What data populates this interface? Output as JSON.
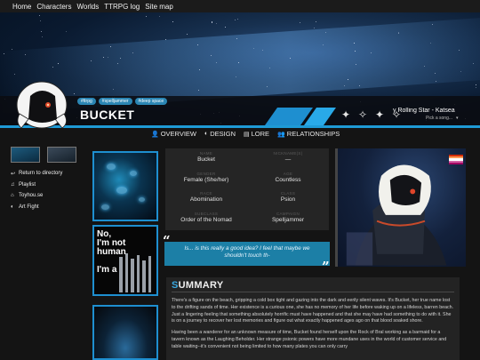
{
  "nav": [
    "Home",
    "Characters",
    "Worlds",
    "TTRPG log",
    "Site map"
  ],
  "profile": {
    "tags": [
      "#ttrpg",
      "#spelljammer",
      "#deep space"
    ],
    "name": "BUCKET",
    "music": {
      "song": "y Rolling Star - Katsea",
      "picker": "Pick a song...",
      "picker_arrow": "▾"
    },
    "sprites": [
      "sprite-a-icon",
      "sprite-b-icon",
      "sprite-c-icon",
      "sprite-d-icon"
    ]
  },
  "tabs": [
    {
      "icon": "person-icon",
      "glyph": "👤",
      "label": "OVERVIEW"
    },
    {
      "icon": "palette-icon",
      "glyph": "◐",
      "label": "DESIGN"
    },
    {
      "icon": "book-icon",
      "glyph": "▤",
      "label": "LORE"
    },
    {
      "icon": "people-icon",
      "glyph": "👥",
      "label": "RELATIONSHIPS"
    }
  ],
  "sidebar": [
    {
      "icon": "return-icon",
      "glyph": "↩",
      "label": "Return to directory"
    },
    {
      "icon": "music-icon",
      "glyph": "♫",
      "label": "Playlist"
    },
    {
      "icon": "toyhouse-icon",
      "glyph": "⌂",
      "label": "Toyhou.se"
    },
    {
      "icon": "palette-icon",
      "glyph": "◐",
      "label": "Art Fight"
    }
  ],
  "info": [
    {
      "label": "NAME",
      "value": "Bucket"
    },
    {
      "label": "NICKNAME(S)",
      "value": "—"
    },
    {
      "label": "GENDER",
      "value": "Female (She/her)"
    },
    {
      "label": "AGE",
      "value": "Countless"
    },
    {
      "label": "RACE",
      "value": "Abomination"
    },
    {
      "label": "CLASS",
      "value": "Psion"
    },
    {
      "label": "SUBCLASS",
      "value": "Order of the Nomad"
    },
    {
      "label": "CAMPAIGN",
      "value": "Spelljammer"
    }
  ],
  "gallery": {
    "text_image_lines": [
      "No,",
      "I'm not",
      "human",
      "I'm a"
    ]
  },
  "quote": {
    "text": "Is... is this really a good idea? I feel that maybe we shouldn't touch th-",
    "open_mark": "“",
    "close_mark": "”"
  },
  "summary": {
    "title_first": "S",
    "title_rest": "UMMARY",
    "paragraphs": [
      "There's a figure on the beach, gripping a cold box tight and gazing into the dark and eerily silent waves. It's Bucket, her true name lost to the drifting sands of time. Her existence is a curious one, she has no memory of her life before waking up on a lifeless, barren beach. Just a lingering feeling that something absolutely horrific must have happened and that she may have had something to do with it. She is on a journey to recover her lost memories and figure out what exactly happened ages ago on that blood soaked shore.",
      "Having been a wanderer for an unknown measure of time, Bucket found herself upon the Rock of Bral working as a barmaid for a tavern known as the Laughing Beholder. Her strange psionic powers have more mundane uses in the world of customer service and table waiting--it's convenient not being limited to how many plates you can only carry"
    ]
  },
  "colors": {
    "accent": "#1e9ad6",
    "tag": "#2b86b4",
    "quote_bg": "#1c7fa6",
    "panel": "#252525"
  }
}
